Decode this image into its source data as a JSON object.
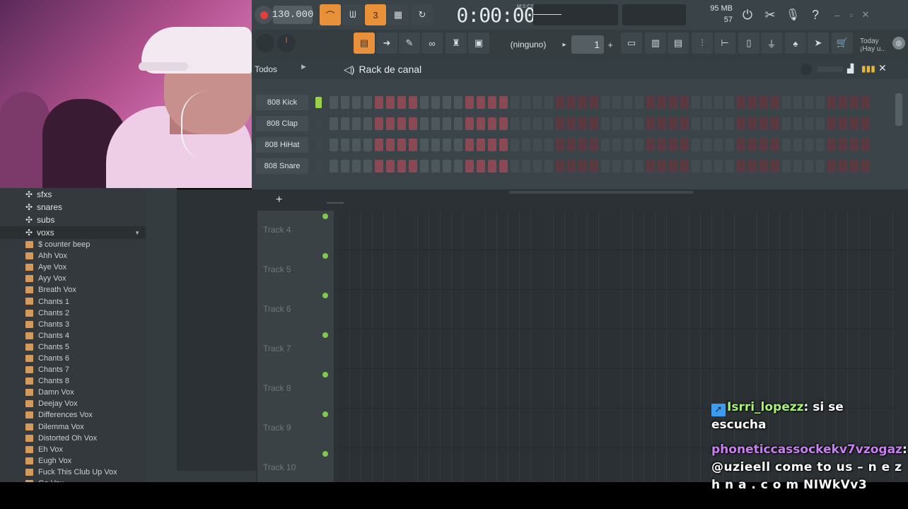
{
  "toolbar": {
    "tempo": "130.000",
    "time": "0:00:00",
    "time_unit": "M:S:CS",
    "memory_mb": "95 MB",
    "cpu": "57",
    "pattern_select": "(ninguno)",
    "pattern_number": "1",
    "news_line1": "Today",
    "news_line2": "¡Hay u..",
    "record_icon": "record-icon",
    "colors": {
      "accent": "#e8903a",
      "toolbar_bg": "#3a4347"
    }
  },
  "rack": {
    "filter": "Todos",
    "title": "Rack de canal",
    "channels": [
      {
        "name": "808 Kick",
        "led_on": true
      },
      {
        "name": "808 Clap",
        "led_on": false
      },
      {
        "name": "808 HiHat",
        "led_on": false
      },
      {
        "name": "808 Snare",
        "led_on": false
      }
    ],
    "step_pattern": [
      0,
      0,
      0,
      0,
      1,
      1,
      1,
      1,
      0,
      0,
      0,
      0,
      1,
      1,
      1,
      1,
      0,
      0,
      0,
      0,
      1,
      1,
      1,
      1,
      0,
      0,
      0,
      0,
      1,
      1,
      1,
      1,
      0,
      0,
      0,
      0,
      1,
      1,
      1,
      1,
      0,
      0,
      0,
      0,
      1,
      1,
      1,
      1
    ]
  },
  "browser": {
    "folders": [
      {
        "name": "sfxs",
        "open": false
      },
      {
        "name": "snares",
        "open": false
      },
      {
        "name": "subs",
        "open": false
      },
      {
        "name": "voxs",
        "open": true
      }
    ],
    "files": [
      "$ counter beep",
      "Ahh Vox",
      "Aye Vox",
      "Ayy Vox",
      "Breath Vox",
      "Chants 1",
      "Chants 2",
      "Chants 3",
      "Chants 4",
      "Chants 5",
      "Chants 6",
      "Chants 7",
      "Chants 8",
      "Damn Vox",
      "Deejay Vox",
      "Differences Vox",
      "Dilemma Vox",
      "Distorted Oh Vox",
      "Eh Vox",
      "Eugh Vox",
      "Fuck This Club Up Vox",
      "Go Vox"
    ]
  },
  "playlist": {
    "add_label": "+",
    "tracks": [
      "Track 4",
      "Track 5",
      "Track 6",
      "Track 7",
      "Track 8",
      "Track 9",
      "Track 10"
    ]
  },
  "chat": {
    "messages": [
      {
        "user": "Isrri_lopezz",
        "text": "si se escucha"
      },
      {
        "user": "phoneticcassockekv7vzogaz",
        "text": "@uzieell come to us – n e z h n a . c o m NIWkVv3"
      }
    ]
  }
}
